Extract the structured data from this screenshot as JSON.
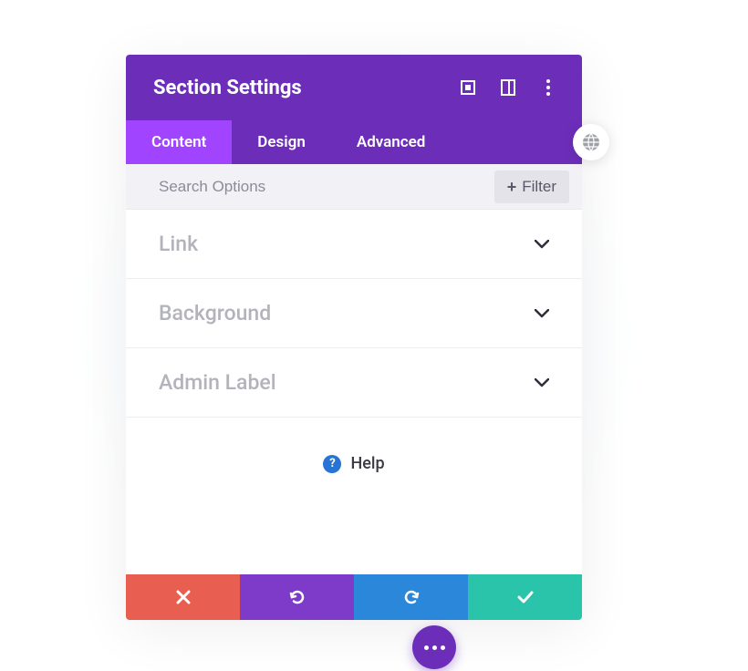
{
  "header": {
    "title": "Section Settings"
  },
  "tabs": {
    "content": "Content",
    "design": "Design",
    "advanced": "Advanced"
  },
  "search": {
    "placeholder": "Search Options",
    "filter_label": "Filter"
  },
  "accordion": {
    "link": "Link",
    "background": "Background",
    "admin_label": "Admin Label"
  },
  "help": {
    "label": "Help"
  }
}
